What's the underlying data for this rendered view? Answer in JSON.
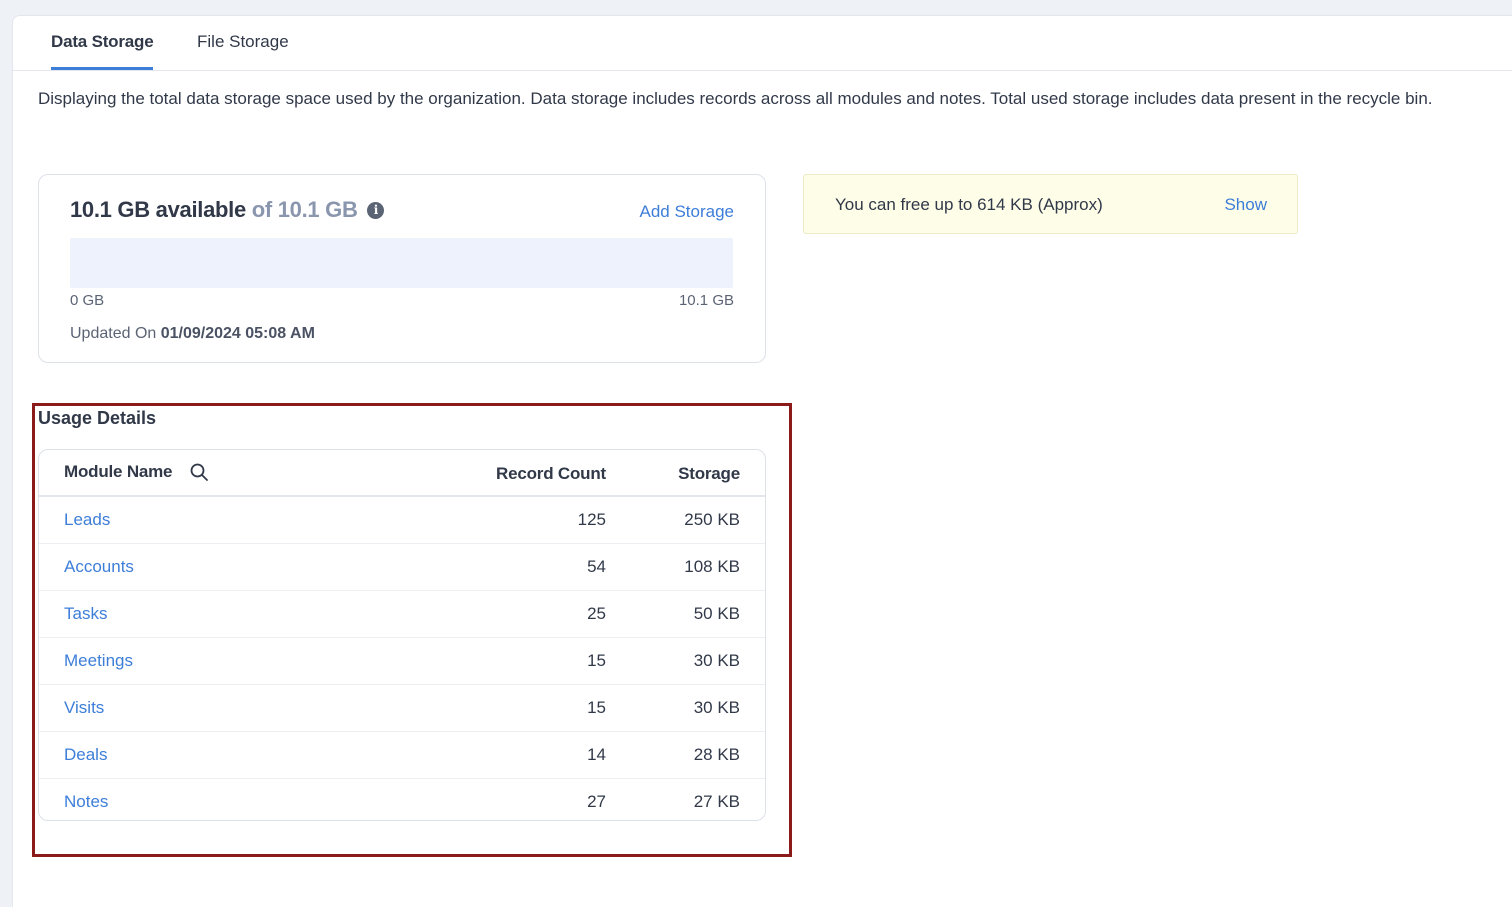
{
  "tabs": [
    {
      "label": "Data Storage",
      "active": true
    },
    {
      "label": "File Storage",
      "active": false
    }
  ],
  "description": "Displaying the total data storage space used by the organization. Data storage includes records across all modules and notes. Total used storage includes data present in the recycle bin.",
  "storage": {
    "available": "10.1 GB available",
    "of_total": "of 10.1 GB",
    "info_icon": "info-icon",
    "add_storage_label": "Add Storage",
    "used_fraction": 0,
    "bar_min_label": "0 GB",
    "bar_max_label": "10.1 GB",
    "updated_prefix": "Updated On",
    "updated_value": "01/09/2024 05:08 AM"
  },
  "free_banner": {
    "text": "You can free up to 614 KB (Approx)",
    "show_label": "Show"
  },
  "usage": {
    "title": "Usage Details",
    "columns": {
      "module": "Module Name",
      "record_count": "Record Count",
      "storage": "Storage"
    },
    "search_icon": "search-icon",
    "rows": [
      {
        "name": "Leads",
        "count": "125",
        "storage": "250 KB"
      },
      {
        "name": "Accounts",
        "count": "54",
        "storage": "108 KB"
      },
      {
        "name": "Tasks",
        "count": "25",
        "storage": "50 KB"
      },
      {
        "name": "Meetings",
        "count": "15",
        "storage": "30 KB"
      },
      {
        "name": "Visits",
        "count": "15",
        "storage": "30 KB"
      },
      {
        "name": "Deals",
        "count": "14",
        "storage": "28 KB"
      },
      {
        "name": "Notes",
        "count": "27",
        "storage": "27 KB"
      }
    ]
  },
  "colors": {
    "accent": "#3d7ed8",
    "highlight_border": "#8b1a1a",
    "banner_bg": "#fdfde8"
  }
}
